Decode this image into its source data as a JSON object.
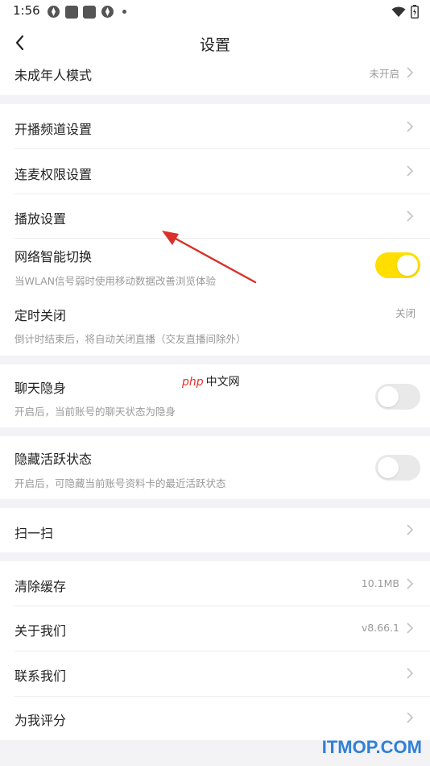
{
  "status_bar": {
    "time": "1:56"
  },
  "header": {
    "title": "设置"
  },
  "rows": {
    "minor_mode": {
      "label": "未成年人模式",
      "value": "未开启"
    },
    "channel": {
      "label": "开播频道设置"
    },
    "mic_permission": {
      "label": "连麦权限设置"
    },
    "playback": {
      "label": "播放设置"
    },
    "network": {
      "label": "网络智能切换",
      "desc": "当WLAN信号弱时使用移动数据改善浏览体验",
      "enabled": true
    },
    "timer": {
      "label": "定时关闭",
      "desc": "倒计时结束后，将自动关闭直播（交友直播间除外）",
      "value": "关闭"
    },
    "chat_stealth": {
      "label": "聊天隐身",
      "desc": "开启后，当前账号的聊天状态为隐身",
      "enabled": false
    },
    "hide_active": {
      "label": "隐藏活跃状态",
      "desc": "开启后，可隐藏当前账号资料卡的最近活跃状态",
      "enabled": false
    },
    "scan": {
      "label": "扫一扫"
    },
    "clear_cache": {
      "label": "清除缓存",
      "value": "10.1MB"
    },
    "about": {
      "label": "关于我们",
      "value": "v8.66.1"
    },
    "contact": {
      "label": "联系我们"
    },
    "rate": {
      "label": "为我评分"
    }
  },
  "watermarks": {
    "php_logo": "php",
    "php_text": "中文网",
    "site": "ITMOP.COM"
  },
  "colors": {
    "toggle_on": "#ffde00",
    "toggle_off": "#e9e9e9",
    "annotation_arrow": "#d9302a",
    "site_watermark": "#2f80d6"
  }
}
